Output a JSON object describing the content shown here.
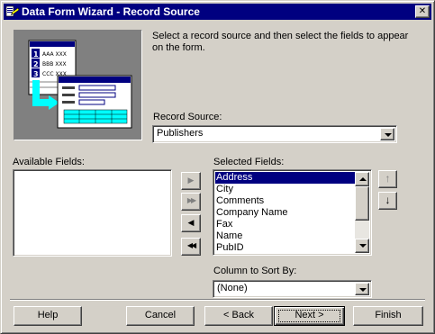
{
  "window": {
    "title": "Data Form Wizard - Record Source",
    "close_glyph": "✕",
    "accent": "#000080",
    "face": "#d4d0c8"
  },
  "illustration": {
    "rows": [
      {
        "num": "1",
        "text": "AAA XXX"
      },
      {
        "num": "2",
        "text": "BBB XXX"
      },
      {
        "num": "3",
        "text": "CCC XXX"
      }
    ],
    "arrow_color": "#00ffff"
  },
  "instructions": "Select a record source and then select the fields to appear on the form.",
  "record_source": {
    "label": "Record Source:",
    "value": "Publishers"
  },
  "available_fields": {
    "label": "Available Fields:",
    "items": []
  },
  "move_buttons": {
    "add_one": "▶",
    "add_all": "▶▶",
    "remove_one": "◀",
    "remove_all": "◀◀"
  },
  "selected_fields": {
    "label": "Selected Fields:",
    "items": [
      "Address",
      "City",
      "Comments",
      "Company Name",
      "Fax",
      "Name",
      "PubID"
    ],
    "selected": "Address"
  },
  "order_buttons": {
    "up": "↑",
    "down": "↓"
  },
  "sort": {
    "label": "Column to Sort By:",
    "value": "(None)"
  },
  "buttons": {
    "help": "Help",
    "cancel": "Cancel",
    "back": "< Back",
    "next": "Next >",
    "finish": "Finish"
  }
}
